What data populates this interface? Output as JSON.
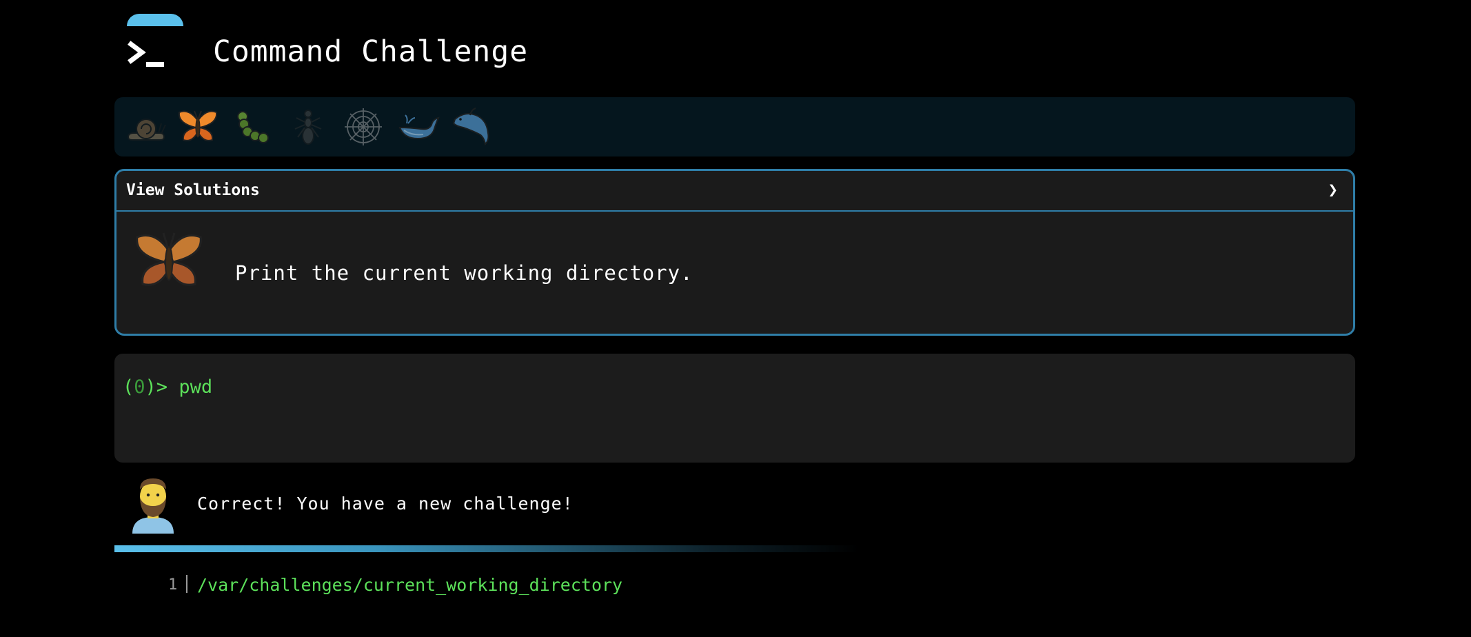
{
  "header": {
    "title": "Command Challenge",
    "logo_icon": "terminal-prompt-icon",
    "accent": "#5bc0eb"
  },
  "levels": {
    "items": [
      {
        "name": "snail",
        "icon": "snail-icon"
      },
      {
        "name": "butterfly",
        "icon": "butterfly-icon",
        "active": true
      },
      {
        "name": "caterpillar",
        "icon": "caterpillar-icon"
      },
      {
        "name": "ant",
        "icon": "ant-icon"
      },
      {
        "name": "spider-web",
        "icon": "spider-web-icon"
      },
      {
        "name": "whale",
        "icon": "whale-icon"
      },
      {
        "name": "dolphin",
        "icon": "dolphin-icon"
      }
    ]
  },
  "challenge": {
    "solutions_label": "View Solutions",
    "chevron": "❯",
    "icon": "butterfly-icon",
    "description": "Print the current working directory."
  },
  "terminal": {
    "prompt_open": "(",
    "prompt_count": "0",
    "prompt_close": ")> ",
    "command": "pwd"
  },
  "feedback": {
    "avatar_icon": "bearded-man-icon",
    "message": "Correct! You have a new challenge!"
  },
  "output": {
    "line_number": "1",
    "text": "/var/challenges/current_working_directory"
  },
  "colors": {
    "border": "#2f7ea8",
    "prompt": "#5ce05a",
    "panel_bg": "#1b1b1b",
    "levels_bg": "#05161e"
  }
}
